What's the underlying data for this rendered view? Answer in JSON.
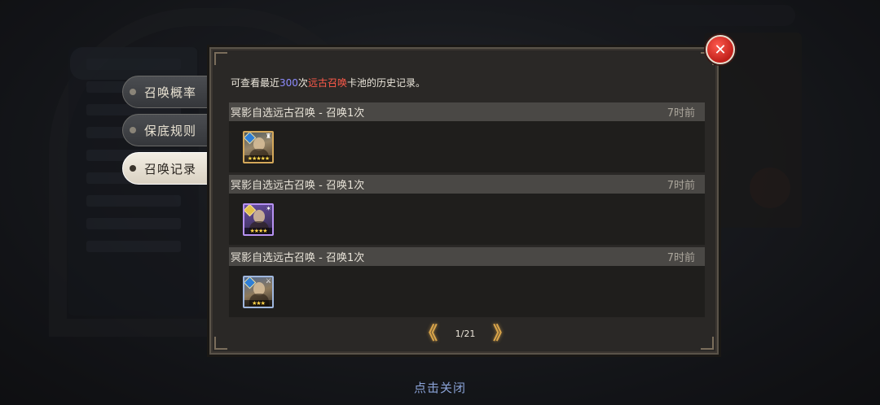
{
  "tabs": [
    {
      "label": "召唤概率",
      "active": false
    },
    {
      "label": "保底规则",
      "active": false
    },
    {
      "label": "召唤记录",
      "active": true
    }
  ],
  "info": {
    "prefix": "可查看最近",
    "count": "300",
    "count_suffix": "次",
    "pool": "远古召唤",
    "suffix": "卡池的历史记录。"
  },
  "entries": [
    {
      "title": "冥影自选远古召唤 - 召唤1次",
      "time": "7时前",
      "hero_stars": "★★★★★",
      "hero_rarity": "gold"
    },
    {
      "title": "冥影自选远古召唤 - 召唤1次",
      "time": "7时前",
      "hero_stars": "★★★★",
      "hero_rarity": "purple"
    },
    {
      "title": "冥影自选远古召唤 - 召唤1次",
      "time": "7时前",
      "hero_stars": "★★★",
      "hero_rarity": "blue"
    }
  ],
  "pager": {
    "text": "1/21",
    "prev": "《",
    "next": "》"
  },
  "close_label": "点击关闭",
  "close_icon": "✕",
  "colors": {
    "count": "#8e8cff",
    "pool": "#ff5a4a",
    "pager": "#d8a44a",
    "close_text": "#8aa2d6"
  }
}
